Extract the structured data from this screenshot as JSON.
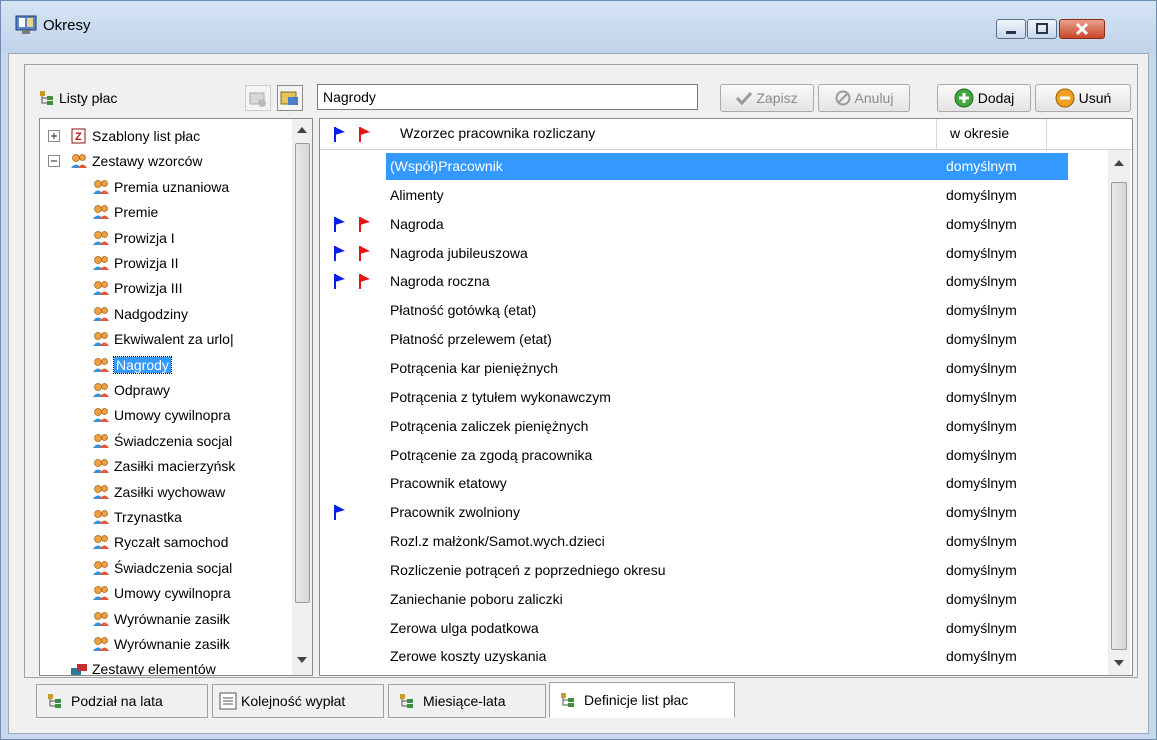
{
  "window": {
    "title": "Okresy"
  },
  "left_panel": {
    "header_label": "Listy płac"
  },
  "tree": [
    {
      "label": "Szablony list płac",
      "level": 0,
      "expander": "+",
      "icon": "template-icon"
    },
    {
      "label": "Zestawy wzorców",
      "level": 0,
      "expander": "−",
      "icon": "people-icon"
    },
    {
      "label": "Premia uznaniowa",
      "level": 1,
      "icon": "people-icon"
    },
    {
      "label": "Premie",
      "level": 1,
      "icon": "people-icon"
    },
    {
      "label": "Prowizja I",
      "level": 1,
      "icon": "people-icon"
    },
    {
      "label": "Prowizja II",
      "level": 1,
      "icon": "people-icon"
    },
    {
      "label": "Prowizja III",
      "level": 1,
      "icon": "people-icon"
    },
    {
      "label": "Nadgodziny",
      "level": 1,
      "icon": "people-icon"
    },
    {
      "label": "Ekwiwalent za urlo|",
      "level": 1,
      "icon": "people-icon"
    },
    {
      "label": "Nagrody",
      "level": 1,
      "icon": "people-icon",
      "selected": true
    },
    {
      "label": "Odprawy",
      "level": 1,
      "icon": "people-icon"
    },
    {
      "label": "Umowy cywilnopra",
      "level": 1,
      "icon": "people-icon"
    },
    {
      "label": "Świadczenia socjal",
      "level": 1,
      "icon": "people-icon"
    },
    {
      "label": "Zasiłki macierzyńsk",
      "level": 1,
      "icon": "people-icon"
    },
    {
      "label": "Zasiłki wychowaw",
      "level": 1,
      "icon": "people-icon"
    },
    {
      "label": "Trzynastka",
      "level": 1,
      "icon": "people-icon"
    },
    {
      "label": "Ryczałt samochod",
      "level": 1,
      "icon": "people-icon"
    },
    {
      "label": "Świadczenia socjal",
      "level": 1,
      "icon": "people-icon"
    },
    {
      "label": "Umowy cywilnopra",
      "level": 1,
      "icon": "people-icon"
    },
    {
      "label": "Wyrównanie zasiłk",
      "level": 1,
      "icon": "people-icon"
    },
    {
      "label": "Wyrównanie zasiłk",
      "level": 1,
      "icon": "people-icon"
    },
    {
      "label": "Zestawy elementów",
      "level": 0,
      "icon": "elements-icon"
    }
  ],
  "editor": {
    "name_value": "Nagrody",
    "save_label": "Zapisz",
    "cancel_label": "Anuluj",
    "add_label": "Dodaj",
    "delete_label": "Usuń"
  },
  "grid": {
    "col_name": "Wzorzec pracownika rozliczany",
    "col_period": "w okresie",
    "rows": [
      {
        "name": "(Współ)Pracownik",
        "period": "domyślnym",
        "blue_flag": false,
        "red_flag": false,
        "selected": true
      },
      {
        "name": "Alimenty",
        "period": "domyślnym",
        "blue_flag": false,
        "red_flag": false
      },
      {
        "name": "Nagroda",
        "period": "domyślnym",
        "blue_flag": true,
        "red_flag": true
      },
      {
        "name": "Nagroda jubileuszowa",
        "period": "domyślnym",
        "blue_flag": true,
        "red_flag": true
      },
      {
        "name": "Nagroda roczna",
        "period": "domyślnym",
        "blue_flag": true,
        "red_flag": true
      },
      {
        "name": "Płatność gotówką (etat)",
        "period": "domyślnym",
        "blue_flag": false,
        "red_flag": false
      },
      {
        "name": "Płatność przelewem (etat)",
        "period": "domyślnym",
        "blue_flag": false,
        "red_flag": false
      },
      {
        "name": "Potrącenia kar pieniężnych",
        "period": "domyślnym",
        "blue_flag": false,
        "red_flag": false
      },
      {
        "name": "Potrącenia z tytułem wykonawczym",
        "period": "domyślnym",
        "blue_flag": false,
        "red_flag": false
      },
      {
        "name": "Potrącenia zaliczek pieniężnych",
        "period": "domyślnym",
        "blue_flag": false,
        "red_flag": false
      },
      {
        "name": "Potrącenie za zgodą pracownika",
        "period": "domyślnym",
        "blue_flag": false,
        "red_flag": false
      },
      {
        "name": "Pracownik etatowy",
        "period": "domyślnym",
        "blue_flag": false,
        "red_flag": false
      },
      {
        "name": "Pracownik zwolniony",
        "period": "domyślnym",
        "blue_flag": true,
        "red_flag": false
      },
      {
        "name": "Rozl.z małżonk/Samot.wych.dzieci",
        "period": "domyślnym",
        "blue_flag": false,
        "red_flag": false
      },
      {
        "name": "Rozliczenie potrąceń z poprzedniego okresu",
        "period": "domyślnym",
        "blue_flag": false,
        "red_flag": false
      },
      {
        "name": "Zaniechanie poboru zaliczki",
        "period": "domyślnym",
        "blue_flag": false,
        "red_flag": false
      },
      {
        "name": "Zerowa ulga podatkowa",
        "period": "domyślnym",
        "blue_flag": false,
        "red_flag": false
      },
      {
        "name": "Zerowe koszty uzyskania",
        "period": "domyślnym",
        "blue_flag": false,
        "red_flag": false
      }
    ]
  },
  "tabs": [
    {
      "label": "Podział na lata",
      "icon": "tree-icon"
    },
    {
      "label": "Kolejność wypłat",
      "icon": "list-icon"
    },
    {
      "label": "Miesiące-lata",
      "icon": "tree-icon"
    },
    {
      "label": "Definicje list płac",
      "icon": "tree-icon",
      "active": true
    }
  ],
  "colors": {
    "selection": "#3399ff",
    "blue_flag": "#0a1ee6",
    "red_flag": "#e61414"
  }
}
